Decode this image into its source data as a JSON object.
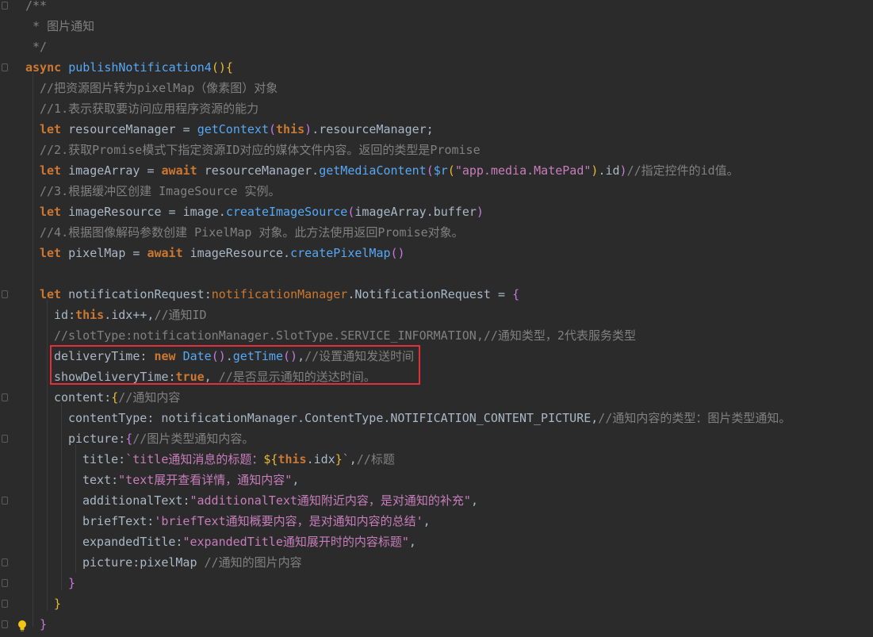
{
  "editor": {
    "lines": [
      {
        "indent": 1,
        "tokens": [
          {
            "t": "/**",
            "c": "cm"
          }
        ]
      },
      {
        "indent": 1,
        "tokens": [
          {
            "t": " * 图片通知",
            "c": "cm"
          }
        ]
      },
      {
        "indent": 1,
        "tokens": [
          {
            "t": " */",
            "c": "cm"
          }
        ]
      },
      {
        "indent": 1,
        "tokens": [
          {
            "t": "async ",
            "c": "kw"
          },
          {
            "t": "publishNotification4",
            "c": "fn"
          },
          {
            "t": "(){",
            "c": "br-y"
          }
        ]
      },
      {
        "indent": 2,
        "tokens": [
          {
            "t": "//把资源图片转为pixelMap（像素图）对象",
            "c": "cm"
          }
        ]
      },
      {
        "indent": 2,
        "tokens": [
          {
            "t": "//1.表示获取要访问应用程序资源的能力",
            "c": "cm"
          }
        ]
      },
      {
        "indent": 2,
        "tokens": [
          {
            "t": "let ",
            "c": "kw"
          },
          {
            "t": "resourceManager = ",
            "c": "nm"
          },
          {
            "t": "getContext",
            "c": "fn"
          },
          {
            "t": "(",
            "c": "br-p"
          },
          {
            "t": "this",
            "c": "kw"
          },
          {
            "t": ")",
            "c": "br-p"
          },
          {
            "t": ".resourceManager;",
            "c": "nm"
          }
        ]
      },
      {
        "indent": 2,
        "tokens": [
          {
            "t": "//2.获取Promise模式下指定资源ID对应的媒体文件内容。返回的类型是Promise",
            "c": "cm"
          }
        ]
      },
      {
        "indent": 2,
        "tokens": [
          {
            "t": "let ",
            "c": "kw"
          },
          {
            "t": "imageArray = ",
            "c": "nm"
          },
          {
            "t": "await ",
            "c": "kw"
          },
          {
            "t": "resourceManager.",
            "c": "nm"
          },
          {
            "t": "getMediaContent",
            "c": "fn"
          },
          {
            "t": "(",
            "c": "br-p"
          },
          {
            "t": "$r",
            "c": "fn"
          },
          {
            "t": "(",
            "c": "br-y"
          },
          {
            "t": "\"app.media.MatePad\"",
            "c": "ts"
          },
          {
            "t": ")",
            "c": "br-y"
          },
          {
            "t": ".id",
            "c": "nm"
          },
          {
            "t": ")",
            "c": "br-p"
          },
          {
            "t": "//指定控件的id值。",
            "c": "cm"
          }
        ]
      },
      {
        "indent": 2,
        "tokens": [
          {
            "t": "//3.根据缓冲区创建 ImageSource 实例。",
            "c": "cm"
          }
        ]
      },
      {
        "indent": 2,
        "tokens": [
          {
            "t": "let ",
            "c": "kw"
          },
          {
            "t": "imageResource = image.",
            "c": "nm"
          },
          {
            "t": "createImageSource",
            "c": "fn"
          },
          {
            "t": "(",
            "c": "br-p"
          },
          {
            "t": "imageArray.buffer",
            "c": "nm"
          },
          {
            "t": ")",
            "c": "br-p"
          }
        ]
      },
      {
        "indent": 2,
        "tokens": [
          {
            "t": "//4.根据图像解码参数创建 PixelMap 对象。此方法使用返回Promise对象。",
            "c": "cm"
          }
        ]
      },
      {
        "indent": 2,
        "tokens": [
          {
            "t": "let ",
            "c": "kw"
          },
          {
            "t": "pixelMap = ",
            "c": "nm"
          },
          {
            "t": "await ",
            "c": "kw"
          },
          {
            "t": "imageResource.",
            "c": "nm"
          },
          {
            "t": "createPixelMap",
            "c": "fn"
          },
          {
            "t": "()",
            "c": "br-p"
          }
        ]
      },
      {
        "indent": 2,
        "tokens": []
      },
      {
        "indent": 2,
        "tokens": [
          {
            "t": "let ",
            "c": "kw"
          },
          {
            "t": "notificationRequest",
            "c": "nm"
          },
          {
            "t": ":",
            "c": "nm"
          },
          {
            "t": "notificationManager",
            "c": "pu"
          },
          {
            "t": ".NotificationRequest = ",
            "c": "nm"
          },
          {
            "t": "{",
            "c": "br-p"
          }
        ]
      },
      {
        "indent": 3,
        "tokens": [
          {
            "t": "id",
            "c": "nm"
          },
          {
            "t": ":",
            "c": "nm"
          },
          {
            "t": "this",
            "c": "kw"
          },
          {
            "t": ".idx++,",
            "c": "nm"
          },
          {
            "t": "//通知ID",
            "c": "cm"
          }
        ]
      },
      {
        "indent": 3,
        "tokens": [
          {
            "t": "//slotType:notificationManager.SlotType.SERVICE_INFORMATION,//通知类型，2代表服务类型",
            "c": "cm"
          }
        ]
      },
      {
        "indent": 3,
        "tokens": [
          {
            "t": "deliveryTime",
            "c": "nm"
          },
          {
            "t": ": ",
            "c": "nm"
          },
          {
            "t": "new ",
            "c": "kw"
          },
          {
            "t": "Date",
            "c": "fn"
          },
          {
            "t": "()",
            "c": "br-p"
          },
          {
            "t": ".",
            "c": "nm"
          },
          {
            "t": "getTime",
            "c": "fn"
          },
          {
            "t": "()",
            "c": "br-p"
          },
          {
            "t": ",",
            "c": "nm"
          },
          {
            "t": "//设置通知发送时间",
            "c": "cm"
          }
        ]
      },
      {
        "indent": 3,
        "tokens": [
          {
            "t": "showDeliveryTime",
            "c": "nm"
          },
          {
            "t": ":",
            "c": "nm"
          },
          {
            "t": "true",
            "c": "kw"
          },
          {
            "t": ", ",
            "c": "nm"
          },
          {
            "t": "//是否显示通知的送达时间。",
            "c": "cm"
          }
        ]
      },
      {
        "indent": 3,
        "tokens": [
          {
            "t": "content",
            "c": "nm"
          },
          {
            "t": ":",
            "c": "nm"
          },
          {
            "t": "{",
            "c": "br-y"
          },
          {
            "t": "//通知内容",
            "c": "cm"
          }
        ]
      },
      {
        "indent": 4,
        "tokens": [
          {
            "t": "contentType",
            "c": "nm"
          },
          {
            "t": ": notificationManager.ContentType.NOTIFICATION_CONTENT_PICTURE,",
            "c": "nm"
          },
          {
            "t": "//通知内容的类型：图片类型通知。",
            "c": "cm"
          }
        ]
      },
      {
        "indent": 4,
        "tokens": [
          {
            "t": "picture",
            "c": "nm"
          },
          {
            "t": ":",
            "c": "nm"
          },
          {
            "t": "{",
            "c": "br-p"
          },
          {
            "t": "//图片类型通知内容。",
            "c": "cm"
          }
        ]
      },
      {
        "indent": 5,
        "tokens": [
          {
            "t": "title",
            "c": "nm"
          },
          {
            "t": ":",
            "c": "nm"
          },
          {
            "t": "`title通知消息的标题：",
            "c": "ts"
          },
          {
            "t": "${",
            "c": "br-y"
          },
          {
            "t": "this",
            "c": "kw"
          },
          {
            "t": ".idx",
            "c": "nm"
          },
          {
            "t": "}",
            "c": "br-y"
          },
          {
            "t": "`",
            "c": "ts"
          },
          {
            "t": ",",
            "c": "nm"
          },
          {
            "t": "//标题",
            "c": "cm"
          }
        ]
      },
      {
        "indent": 5,
        "tokens": [
          {
            "t": "text",
            "c": "nm"
          },
          {
            "t": ":",
            "c": "nm"
          },
          {
            "t": "\"text展开查看详情，通知内容\"",
            "c": "ts"
          },
          {
            "t": ",",
            "c": "nm"
          }
        ]
      },
      {
        "indent": 5,
        "tokens": [
          {
            "t": "additionalText",
            "c": "nm"
          },
          {
            "t": ":",
            "c": "nm"
          },
          {
            "t": "\"additionalText通知附近内容，是对通知的补充\"",
            "c": "ts"
          },
          {
            "t": ",",
            "c": "nm"
          }
        ]
      },
      {
        "indent": 5,
        "tokens": [
          {
            "t": "briefText",
            "c": "nm"
          },
          {
            "t": ":",
            "c": "nm"
          },
          {
            "t": "'briefText通知概要内容，是对通知内容的总结'",
            "c": "ts"
          },
          {
            "t": ",",
            "c": "nm"
          }
        ]
      },
      {
        "indent": 5,
        "tokens": [
          {
            "t": "expandedTitle",
            "c": "nm"
          },
          {
            "t": ":",
            "c": "nm"
          },
          {
            "t": "\"expandedTitle通知展开时的内容标题\"",
            "c": "ts"
          },
          {
            "t": ",",
            "c": "nm"
          }
        ]
      },
      {
        "indent": 5,
        "tokens": [
          {
            "t": "picture",
            "c": "nm"
          },
          {
            "t": ":pixelMap ",
            "c": "nm"
          },
          {
            "t": "//通知的图片内容",
            "c": "cm"
          }
        ]
      },
      {
        "indent": 4,
        "tokens": [
          {
            "t": "}",
            "c": "br-p"
          }
        ]
      },
      {
        "indent": 3,
        "tokens": [
          {
            "t": "}",
            "c": "br-y"
          }
        ]
      },
      {
        "indent": 2,
        "tokens": [
          {
            "t": "}",
            "c": "br-p"
          }
        ]
      }
    ]
  },
  "colors": {
    "background": "#2b2b2b",
    "highlight_border": "#e0303a"
  },
  "icons": {
    "gutter_bulb": "lightbulb-icon"
  }
}
